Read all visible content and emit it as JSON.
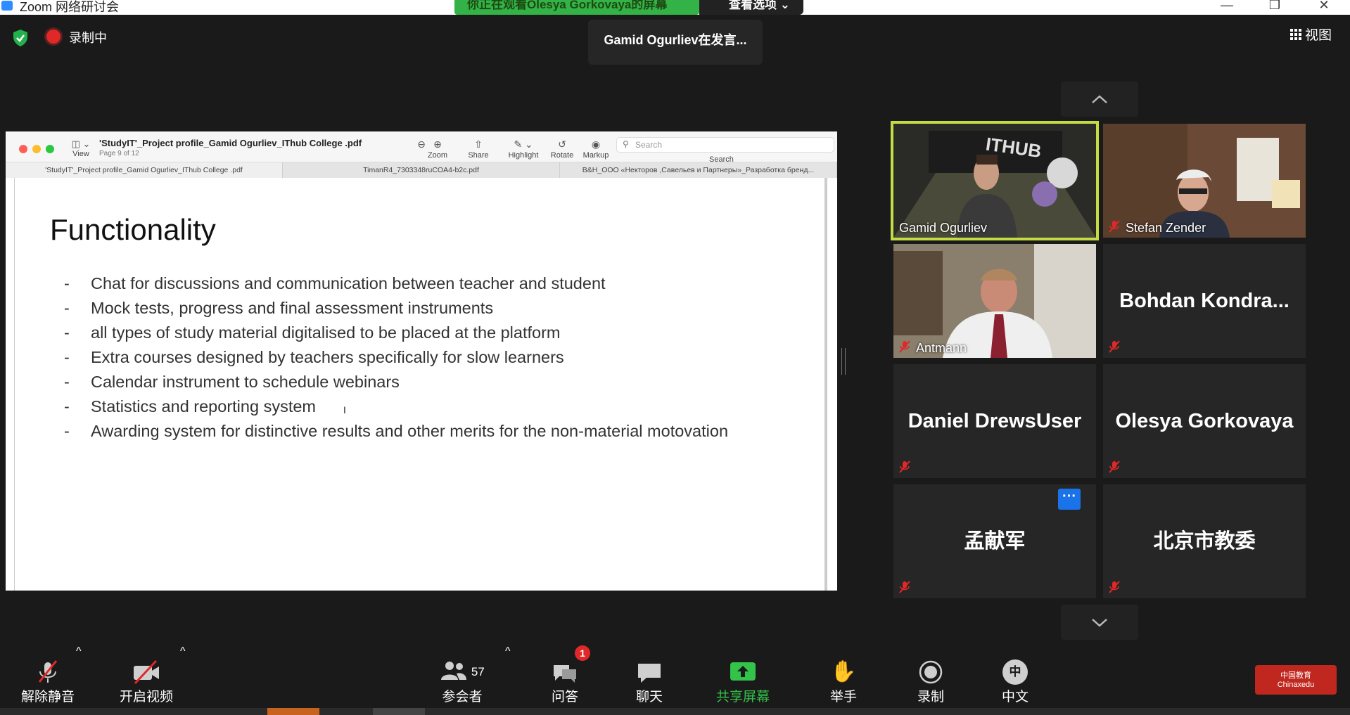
{
  "window": {
    "title": "Zoom 网络研讨会",
    "share_banner": "你正在观看Olesya Gorkovaya的屏幕",
    "view_options": "查看选项"
  },
  "top_bar": {
    "recording_label": "录制中",
    "speaker_notice": "Gamid  Ogurliev在发言...",
    "view_label": "视图"
  },
  "preview": {
    "file_title": "'StudyIT'_Project profile_Gamid Ogurliev_IThub College .pdf",
    "page_indicator": "Page 9 of 12",
    "view_label": "View",
    "tools": {
      "zoom": "Zoom",
      "share": "Share",
      "highlight": "Highlight",
      "rotate": "Rotate",
      "markup": "Markup",
      "search": "Search"
    },
    "search_placeholder": "Search",
    "tabs": [
      "'StudyIT'_Project profile_Gamid Ogurliev_IThub College .pdf",
      "TimanR4_7303348ruCOA4-b2c.pdf",
      "B&H_OOO «Некторов ,Савельев и Партнеры»_Разработка бренд..."
    ]
  },
  "slide": {
    "heading": "Functionality",
    "bullets": [
      "Chat for discussions and communication between teacher and student",
      "Mock tests, progress and final assessment instruments",
      "all types of study material digitalised to be placed at the platform",
      "Extra courses designed by teachers specifically for slow learners",
      "Calendar instrument to schedule webinars",
      "Statistics and reporting system",
      "Awarding system for distinctive results and other merits for the non-material motovation"
    ]
  },
  "gallery": {
    "participants": [
      {
        "name": "Gamid Ogurliev",
        "video": true,
        "active_speaker": true,
        "muted": false
      },
      {
        "name": "Stefan Zender",
        "video": true,
        "muted": true
      },
      {
        "name": "Antmann",
        "video": true,
        "muted": true
      },
      {
        "name": "Bohdan  Kondra...",
        "video": false,
        "muted": true
      },
      {
        "name": "Daniel DrewsUser",
        "video": false,
        "muted": true
      },
      {
        "name": "Olesya Gorkovaya",
        "video": false,
        "muted": true
      },
      {
        "name": "孟献军",
        "video": false,
        "muted": true
      },
      {
        "name": "北京市教委",
        "video": false,
        "muted": true
      }
    ],
    "more_label": "···"
  },
  "toolbar": {
    "unmute": "解除静音",
    "start_video": "开启视频",
    "participants": "参会者",
    "participant_count": "57",
    "qa": "问答",
    "qa_badge": "1",
    "chat": "聊天",
    "share_screen": "共享屏幕",
    "raise_hand": "举手",
    "record": "录制",
    "language": "中文",
    "language_glyph": "中"
  },
  "watermark": {
    "text": "中国教育\nChinaxedu"
  },
  "colors": {
    "background": "#1a1a1a",
    "share_green": "#33b347",
    "active_speaker_border": "#c4dc44",
    "mute_red": "#e02828",
    "accent_blue": "#1a73e8"
  }
}
